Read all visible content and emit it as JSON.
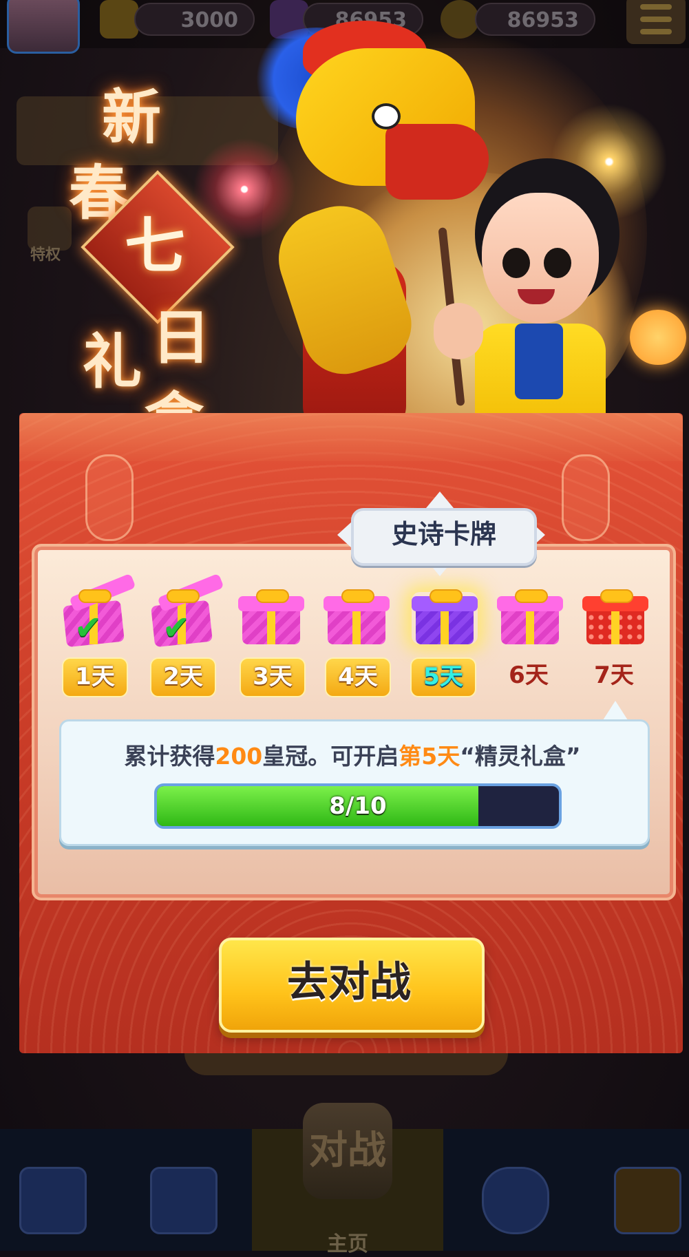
{
  "topbar": {
    "crowns": "3000",
    "gems": "86953",
    "coins": "86953"
  },
  "background": {
    "privilege_label": "特权"
  },
  "event": {
    "title_chars": [
      "新",
      "春",
      "七",
      "日",
      "礼",
      "盒"
    ]
  },
  "tooltip": {
    "text": "史诗卡牌"
  },
  "days": [
    {
      "label": "1天",
      "status": "claimed",
      "box": "pink"
    },
    {
      "label": "2天",
      "status": "claimed",
      "box": "pink"
    },
    {
      "label": "3天",
      "status": "unlocked",
      "box": "pink"
    },
    {
      "label": "4天",
      "status": "unlocked",
      "box": "pink"
    },
    {
      "label": "5天",
      "status": "current",
      "box": "purple"
    },
    {
      "label": "6天",
      "status": "locked",
      "box": "pink"
    },
    {
      "label": "7天",
      "status": "locked",
      "box": "red"
    }
  ],
  "progress": {
    "msg_pre": "累计获得",
    "msg_amount": "200",
    "msg_mid": "皇冠。可开启",
    "msg_day": "第5天",
    "msg_box": "“精灵礼盒”",
    "current": 8,
    "total": 10,
    "label": "8/10"
  },
  "cta": {
    "label": "去对战"
  },
  "bottom_nav": {
    "center_icon_text": "对战",
    "home_label": "主页"
  },
  "colors": {
    "accent_orange": "#ff8a14",
    "button_yellow": "#ffc21a",
    "panel_red": "#c73a26",
    "progress_green": "#2fb816"
  }
}
